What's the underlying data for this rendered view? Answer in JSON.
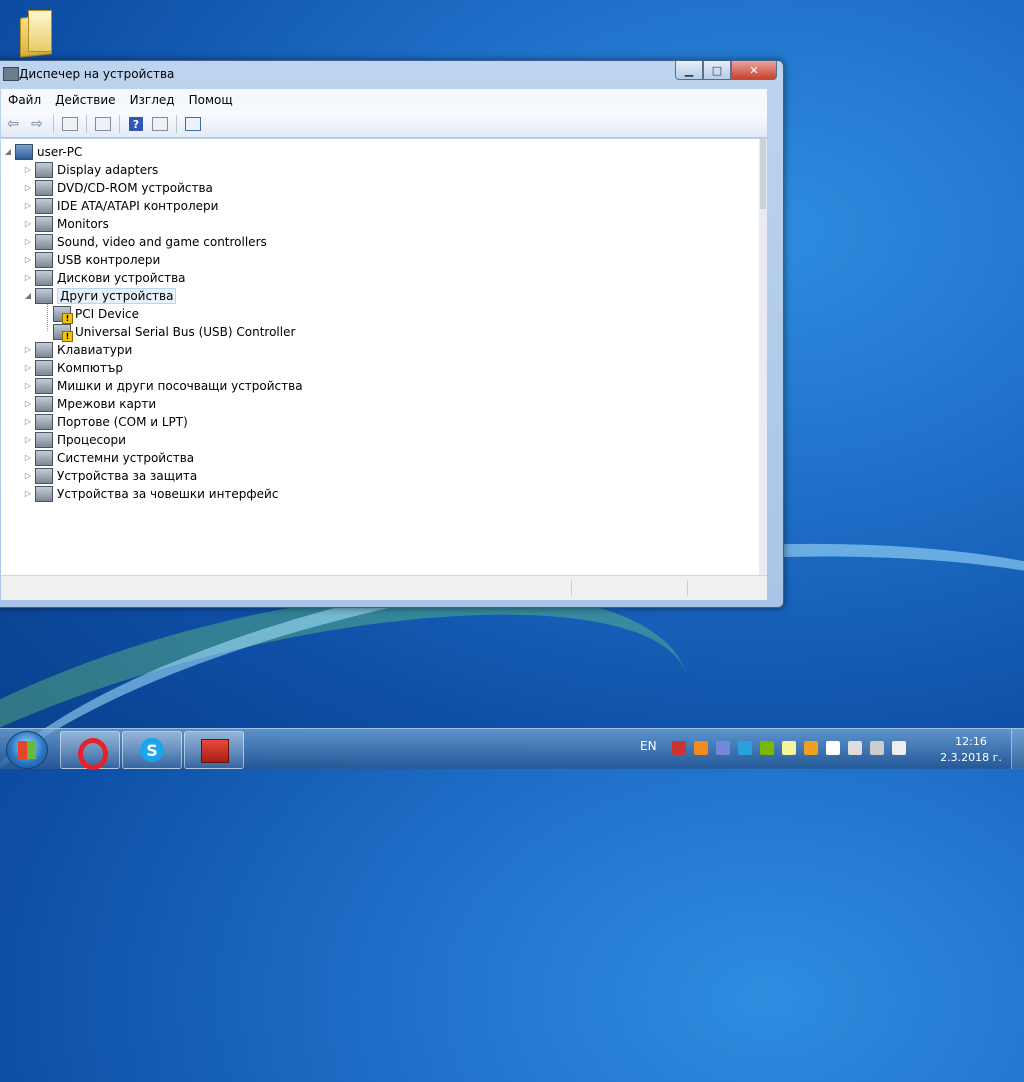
{
  "window": {
    "title": "Диспечер на устройства",
    "controls": {
      "minimize": "▁",
      "maximize": "□",
      "close": "✕"
    }
  },
  "menu": [
    "Файл",
    "Действие",
    "Изглед",
    "Помощ"
  ],
  "toolbar": {
    "icons": [
      "back-icon",
      "forward-icon",
      "show-hide-console-tree-icon",
      "properties-icon",
      "help-icon",
      "action-pane-icon",
      "scan-hardware-icon"
    ],
    "help_glyph": "?"
  },
  "tree": {
    "root": "user-PC",
    "categories": [
      {
        "label": "Display adapters",
        "expanded": false
      },
      {
        "label": "DVD/CD-ROM устройства",
        "expanded": false
      },
      {
        "label": "IDE ATA/ATAPI контролери",
        "expanded": false
      },
      {
        "label": "Monitors",
        "expanded": false
      },
      {
        "label": "Sound, video and game controllers",
        "expanded": false
      },
      {
        "label": "USB контролери",
        "expanded": false
      },
      {
        "label": "Дискови устройства",
        "expanded": false
      },
      {
        "label": "Други устройства",
        "expanded": true,
        "selected": true,
        "children": [
          "PCI Device",
          "Universal Serial Bus (USB) Controller"
        ]
      },
      {
        "label": "Клавиатури",
        "expanded": false
      },
      {
        "label": "Компютър",
        "expanded": false
      },
      {
        "label": "Мишки и други посочващи устройства",
        "expanded": false
      },
      {
        "label": "Мрежови карти",
        "expanded": false
      },
      {
        "label": "Портове (COM и LPT)",
        "expanded": false
      },
      {
        "label": "Процесори",
        "expanded": false
      },
      {
        "label": "Системни устройства",
        "expanded": false
      },
      {
        "label": "Устройства за защита",
        "expanded": false
      },
      {
        "label": "Устройства за човешки интерфейс",
        "expanded": false
      }
    ]
  },
  "taskbar": {
    "apps": [
      "start-button",
      "opera",
      "skype",
      "device-manager"
    ],
    "skype_glyph": "S",
    "language": "EN",
    "time": "12:16",
    "date": "2.3.2018 г."
  },
  "colors": {
    "warning": "#f2c20f",
    "selection": "#e5f1fb",
    "desktop": "#1f6fc8"
  }
}
